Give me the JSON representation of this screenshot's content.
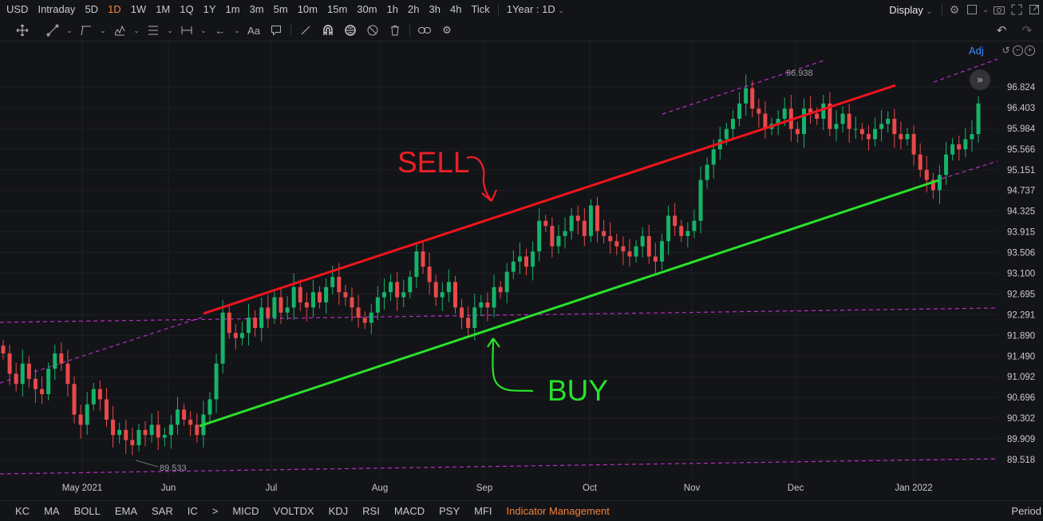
{
  "top": {
    "symbol": "USD",
    "timeframes": [
      "Intraday",
      "5D",
      "1D",
      "1W",
      "1M",
      "1Q",
      "1Y",
      "1m",
      "3m",
      "5m",
      "10m",
      "15m",
      "30m",
      "1h",
      "2h",
      "3h",
      "4h",
      "Tick"
    ],
    "active_timeframe": "1D",
    "range_select": "1Year : 1D",
    "display_label": "Display"
  },
  "side": {
    "adj": "Adj"
  },
  "annotations": {
    "sell": "SELL",
    "buy": "BUY",
    "high_label": "96.938",
    "low_label": "89.533"
  },
  "colors": {
    "up": "#17b26a",
    "down": "#e8494b",
    "sell_line": "#f0141c",
    "buy_line": "#28e12c",
    "channel_dash": "#b72fc6",
    "accent": "#f5813a"
  },
  "bottom": {
    "indicators": [
      "KC",
      "MA",
      "BOLL",
      "EMA",
      "SAR",
      "IC",
      ">",
      "MICD",
      "VOLTDX",
      "KDJ",
      "RSI",
      "MACD",
      "PSY",
      "MFI"
    ],
    "management": "Indicator Management",
    "period": "Period"
  },
  "chart_data": {
    "type": "candlestick",
    "y_ticks": [
      "96.824",
      "96.403",
      "95.984",
      "95.566",
      "95.151",
      "94.737",
      "94.325",
      "93.915",
      "93.506",
      "93.100",
      "92.695",
      "92.291",
      "91.890",
      "91.490",
      "91.092",
      "90.696",
      "90.302",
      "89.909",
      "89.518"
    ],
    "ylim": [
      89.4,
      97.4
    ],
    "x_ticks": [
      "May 2021",
      "Jun",
      "Jul",
      "Aug",
      "Sep",
      "Oct",
      "Nov",
      "Dec",
      "Jan 2022"
    ],
    "closes": [
      91.6,
      91.2,
      91.0,
      91.4,
      91.1,
      90.9,
      90.8,
      91.3,
      91.6,
      91.4,
      91.0,
      90.4,
      90.2,
      90.6,
      90.9,
      90.7,
      90.3,
      90.0,
      90.1,
      89.9,
      89.8,
      90.1,
      90.0,
      90.2,
      89.95,
      90.0,
      90.2,
      90.5,
      90.3,
      90.2,
      90.0,
      90.4,
      90.7,
      91.4,
      92.4,
      92.0,
      91.9,
      92.0,
      92.3,
      92.1,
      92.5,
      92.3,
      92.7,
      92.4,
      92.5,
      92.9,
      92.6,
      92.5,
      92.8,
      92.6,
      92.9,
      93.1,
      92.8,
      92.7,
      92.5,
      92.3,
      92.2,
      92.4,
      92.7,
      92.8,
      93.0,
      92.7,
      92.8,
      93.1,
      93.6,
      93.3,
      93.0,
      92.7,
      92.8,
      93.0,
      92.5,
      92.3,
      92.1,
      92.5,
      92.6,
      92.5,
      92.9,
      92.8,
      93.2,
      93.4,
      93.5,
      93.3,
      93.6,
      94.2,
      94.1,
      93.7,
      93.9,
      94.0,
      94.3,
      94.2,
      93.9,
      94.5,
      94.0,
      93.9,
      93.8,
      93.7,
      93.6,
      93.5,
      93.7,
      93.9,
      93.5,
      93.4,
      93.8,
      94.3,
      94.1,
      93.9,
      94.0,
      94.2,
      95.0,
      95.3,
      95.6,
      95.8,
      96.0,
      96.2,
      96.5,
      96.8,
      96.4,
      96.3,
      96.0,
      96.1,
      96.2,
      96.4,
      96.0,
      95.9,
      96.4,
      96.3,
      96.2,
      96.5,
      96.0,
      96.1,
      96.3,
      96.0,
      96.0,
      95.9,
      95.8,
      96.0,
      96.1,
      96.2,
      95.9,
      95.8,
      95.9,
      95.5,
      95.2,
      95.0,
      94.8,
      95.1,
      95.5,
      95.7,
      95.6,
      95.8,
      95.9,
      96.5
    ]
  }
}
